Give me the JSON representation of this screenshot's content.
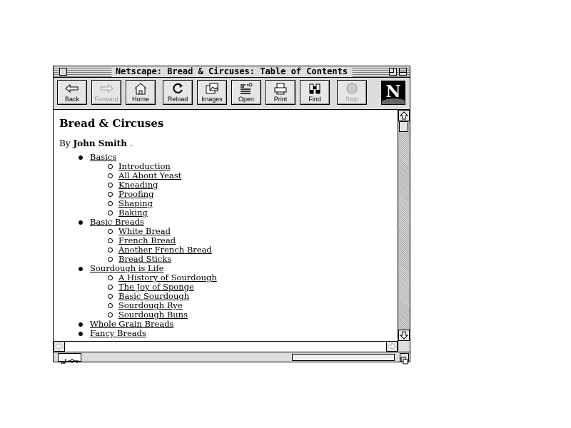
{
  "window": {
    "title": "Netscape: Bread & Circuses: Table of Contents"
  },
  "toolbar": {
    "buttons": [
      {
        "label": "Back",
        "icon": "back-arrow-icon",
        "enabled": true
      },
      {
        "label": "Forward",
        "icon": "forward-arrow-icon",
        "enabled": false
      },
      {
        "label": "Home",
        "icon": "home-icon",
        "enabled": true
      },
      {
        "label": "Reload",
        "icon": "reload-icon",
        "enabled": true
      },
      {
        "label": "Images",
        "icon": "images-icon",
        "enabled": true
      },
      {
        "label": "Open",
        "icon": "open-icon",
        "enabled": true
      },
      {
        "label": "Print",
        "icon": "printer-icon",
        "enabled": true
      },
      {
        "label": "Find",
        "icon": "binoculars-icon",
        "enabled": true
      },
      {
        "label": "Stop",
        "icon": "stop-icon",
        "enabled": false
      }
    ],
    "logo_letter": "N"
  },
  "page": {
    "heading": "Bread & Circuses",
    "byline_prefix": "By",
    "author": "John Smith",
    "byline_suffix": ".",
    "toc": [
      {
        "title": "Basics",
        "items": [
          "Introduction",
          "All About Yeast",
          "Kneading",
          "Proofing",
          "Shaping",
          "Baking"
        ]
      },
      {
        "title": "Basic Breads",
        "items": [
          "White Bread",
          "French Bread",
          "Another French Bread",
          "Bread Sticks"
        ]
      },
      {
        "title": "Sourdough is Life",
        "items": [
          "A History of Sourdough",
          "The Joy of Sponge",
          "Basic Sourdough",
          "Sourdough Rye",
          "Sourdough Buns"
        ]
      },
      {
        "title": "Whole Grain Breads",
        "items": []
      },
      {
        "title": "Fancy Breads",
        "items": []
      }
    ]
  },
  "status": {
    "progress": 0
  },
  "colors": {
    "chrome": "#dddddd",
    "button": "#e6e6e6",
    "text": "#000000",
    "disabled": "#999999"
  }
}
